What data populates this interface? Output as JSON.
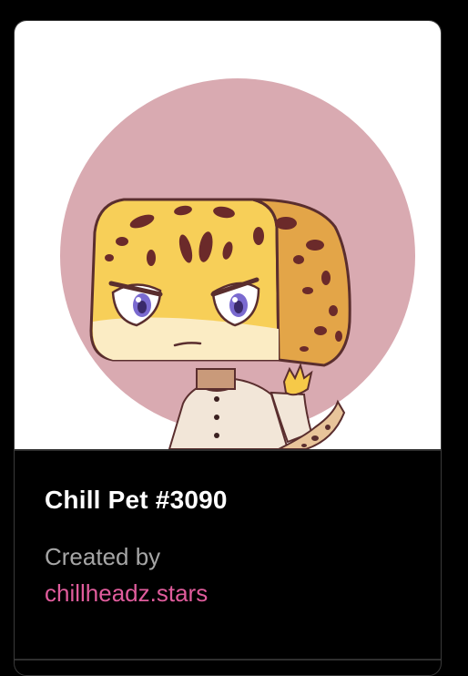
{
  "nft": {
    "title": "Chill Pet #3090",
    "created_by_label": "Created by",
    "creator": "chillheadz.stars"
  },
  "colors": {
    "creator_link": "#e05c9c",
    "background": "#000000",
    "image_circle": "#d9a9b0"
  }
}
